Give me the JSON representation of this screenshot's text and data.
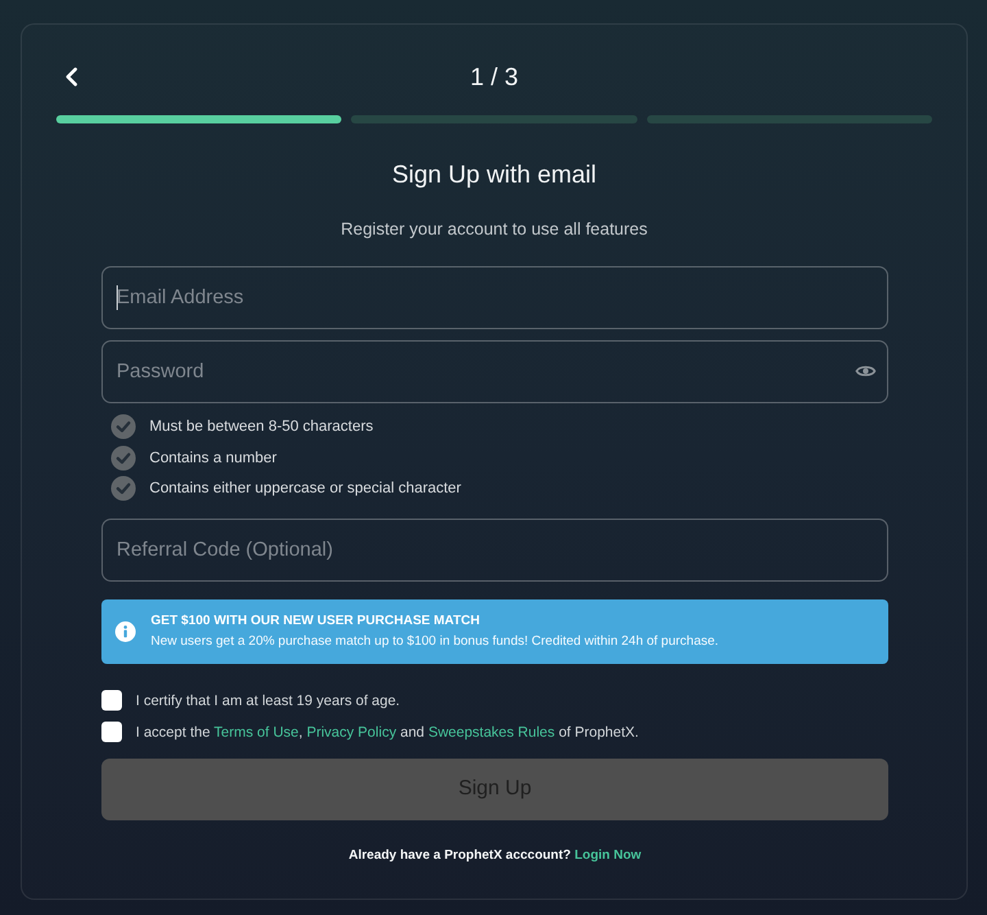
{
  "header": {
    "step": "1 / 3",
    "progress": [
      {
        "done": true
      },
      {
        "done": false
      },
      {
        "done": false
      }
    ]
  },
  "title": "Sign Up with email",
  "subtitle": "Register your account to use all features",
  "email_field": {
    "placeholder": "Email Address",
    "focused": true
  },
  "password_field": {
    "placeholder": "Password"
  },
  "password_rules": [
    {
      "text": "Must be between 8-50 characters",
      "met": false
    },
    {
      "text": "Contains a number",
      "met": false
    },
    {
      "text": "Contains either uppercase or special character",
      "met": false
    }
  ],
  "referral_field": {
    "placeholder": "Referral Code (Optional)"
  },
  "promo": {
    "title": "GET $100 WITH OUR NEW USER PURCHASE MATCH",
    "text": "New users get a 20% purchase match up to $100 in bonus funds! Credited within 24h of purchase."
  },
  "consents": [
    {
      "checked": false,
      "parts": [
        {
          "text": "I certify that I am at least 19 years of age."
        }
      ]
    },
    {
      "checked": false,
      "parts": [
        {
          "text": "I accept the ",
          "link": "Terms of Use"
        },
        {
          "text": ", ",
          "link": "Privacy Policy"
        },
        {
          "text": " and ",
          "link": "Sweepstakes Rules"
        },
        {
          "text": " of ProphetX."
        }
      ]
    }
  ],
  "submit": {
    "label": "Sign Up",
    "disabled": true
  },
  "footer": {
    "text": "Already have a ProphetX acccount?",
    "link": "Login Now"
  }
}
